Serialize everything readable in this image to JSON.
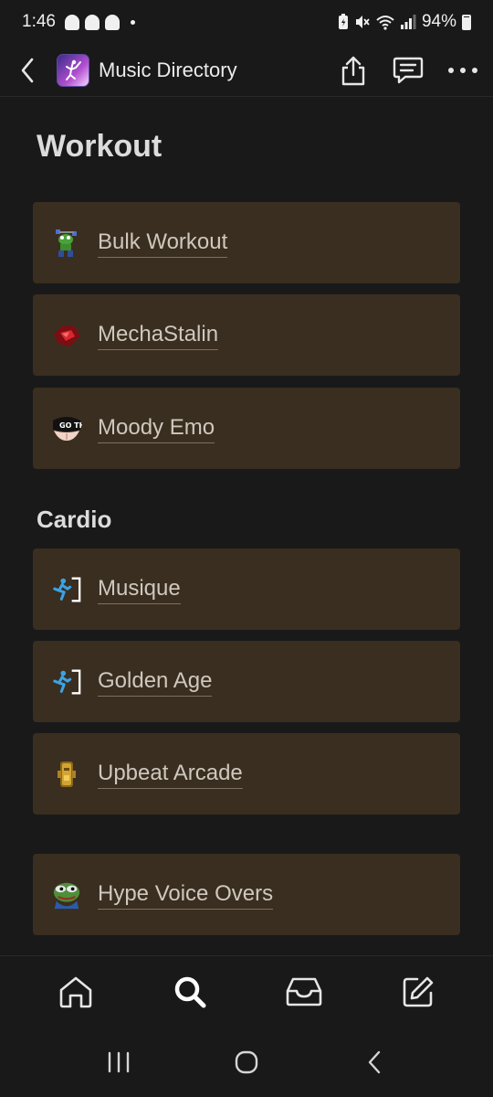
{
  "status_bar": {
    "time": "1:46",
    "battery_percent": "94%",
    "icons": [
      "snapchat-icon",
      "snapchat-icon",
      "snapchat-icon",
      "notification-dot",
      "battery-saver-icon",
      "mute-icon",
      "wifi-icon",
      "signal-icon",
      "battery-icon"
    ]
  },
  "header": {
    "title": "Music Directory",
    "actions": [
      "share-icon",
      "comment-icon",
      "more-icon"
    ]
  },
  "page": {
    "title": "Workout",
    "sections": [
      {
        "title": "",
        "items": [
          {
            "label": "Bulk Workout",
            "icon": "frog-lifter-icon"
          },
          {
            "label": "MechaStalin",
            "icon": "red-gem-icon"
          },
          {
            "label": "Moody Emo",
            "icon": "goth-badge-icon"
          }
        ]
      },
      {
        "title": "Cardio",
        "items": [
          {
            "label": "Musique",
            "icon": "running-exit-icon"
          },
          {
            "label": "Golden Age",
            "icon": "running-exit-icon"
          },
          {
            "label": "Upbeat Arcade",
            "icon": "golden-idol-icon"
          }
        ]
      },
      {
        "title": "",
        "items": [
          {
            "label": "Hype Voice Overs",
            "icon": "pepe-frog-icon"
          }
        ]
      }
    ]
  },
  "bottom_nav": [
    "home-icon",
    "search-icon",
    "inbox-icon",
    "edit-icon"
  ],
  "system_nav": [
    "recents-icon",
    "home-circle-icon",
    "back-chevron-icon"
  ],
  "colors": {
    "background": "#191919",
    "card": "#3a2e20",
    "text": "#cfc8be"
  }
}
